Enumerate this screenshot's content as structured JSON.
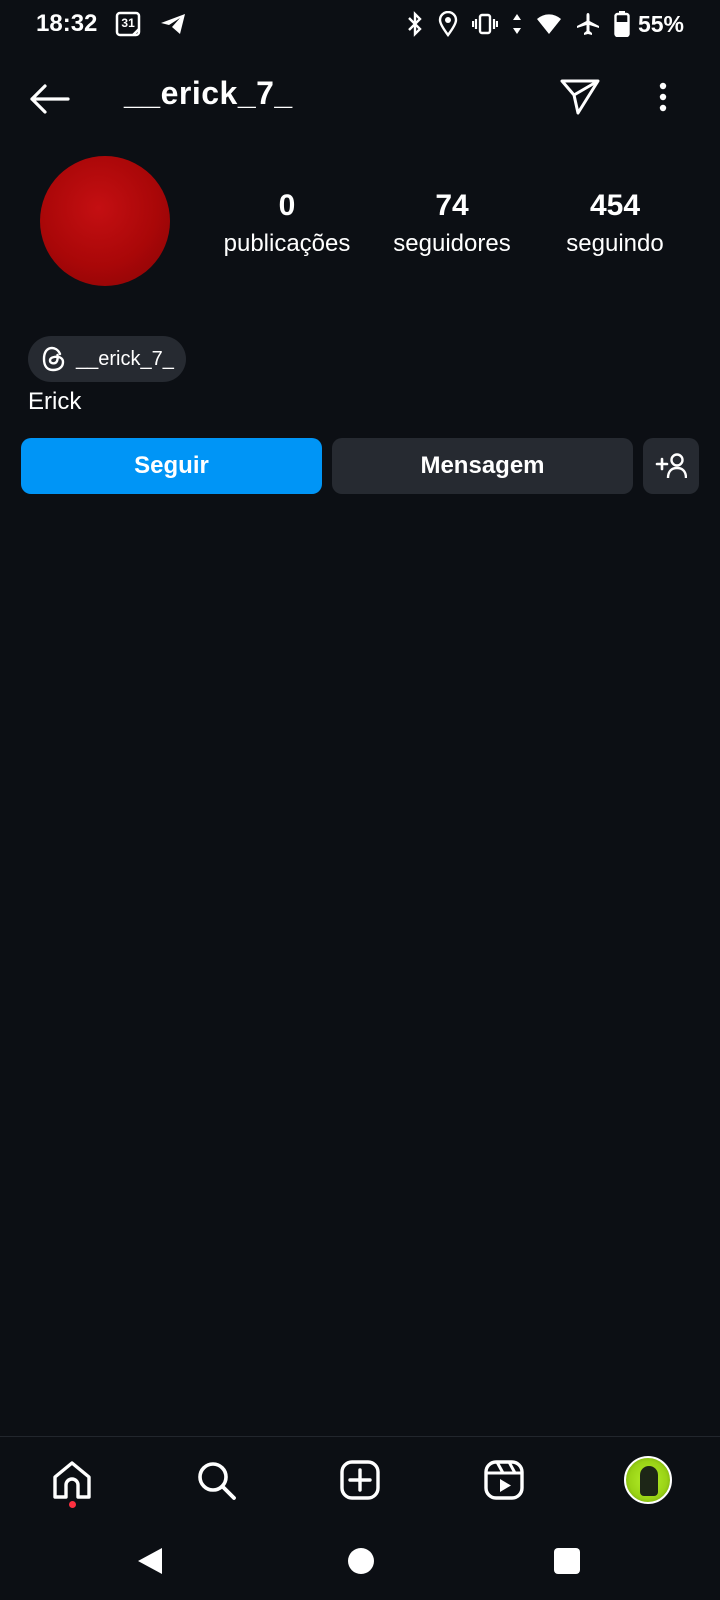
{
  "status_bar": {
    "time": "18:32",
    "calendar_day": "31",
    "battery": "55%",
    "icons": [
      "calendar-icon",
      "telegram-icon",
      "bluetooth-icon",
      "location-icon",
      "vibrate-icon",
      "data-arrows-icon",
      "wifi-icon",
      "airplane-icon",
      "battery-icon"
    ]
  },
  "header": {
    "username": "__erick_7_",
    "back_icon": "arrow-left-icon",
    "send_icon": "paper-plane-icon",
    "more_icon": "more-vertical-icon"
  },
  "profile": {
    "stats": [
      {
        "value": "0",
        "label": "publicações"
      },
      {
        "value": "74",
        "label": "seguidores"
      },
      {
        "value": "454",
        "label": "seguindo"
      }
    ],
    "threads_handle": "__erick_7_",
    "display_name": "Erick"
  },
  "actions": {
    "follow": "Seguir",
    "message": "Mensagem",
    "add_person_icon": "add-person-icon"
  },
  "bottom_nav": {
    "items": [
      "home-icon",
      "search-icon",
      "create-icon",
      "reels-icon",
      "profile-avatar"
    ],
    "home_badge_color": "#ff3040"
  },
  "colors": {
    "background": "#0c0f14",
    "accent": "#0095f6",
    "secondary_button": "#262a31"
  }
}
